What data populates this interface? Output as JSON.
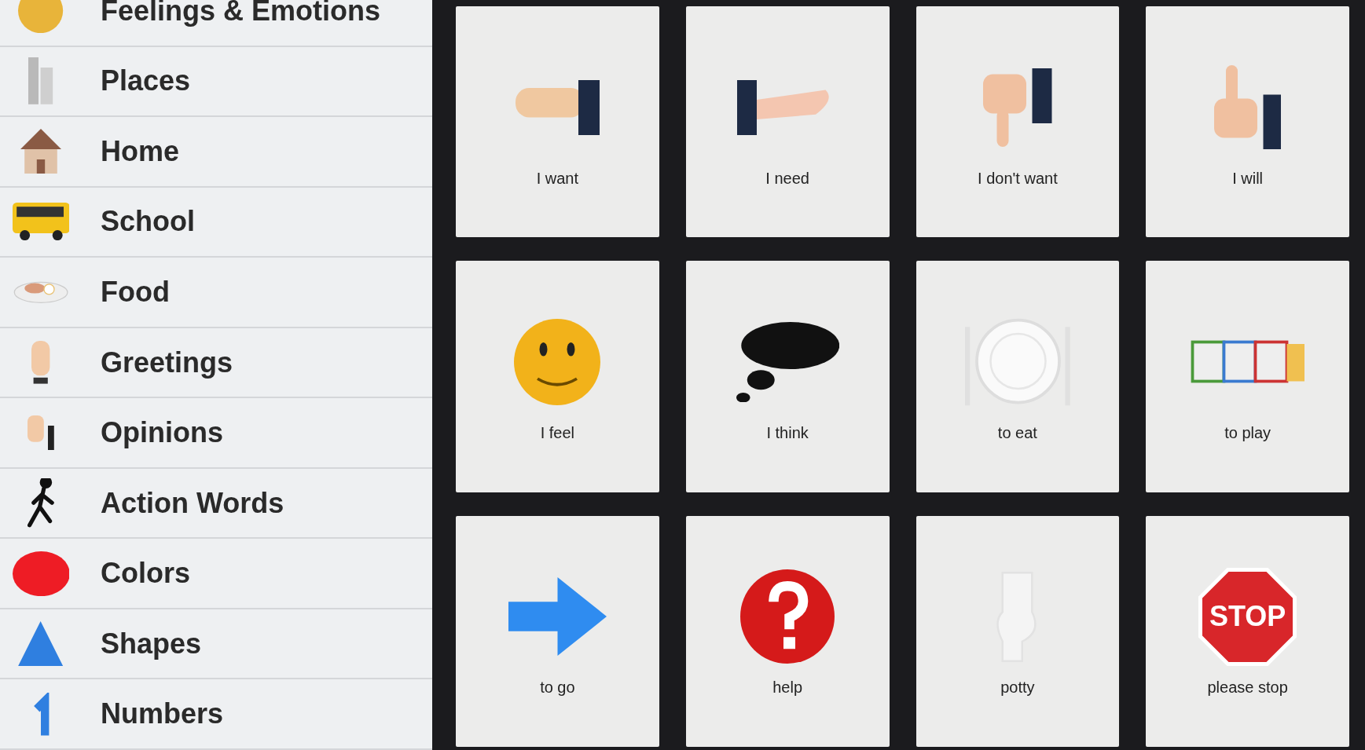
{
  "sidebar": {
    "items": [
      {
        "label": "Feelings & Emotions"
      },
      {
        "label": "Places"
      },
      {
        "label": "Home"
      },
      {
        "label": "School"
      },
      {
        "label": "Food"
      },
      {
        "label": "Greetings"
      },
      {
        "label": "Opinions"
      },
      {
        "label": "Action Words"
      },
      {
        "label": "Colors"
      },
      {
        "label": "Shapes"
      },
      {
        "label": "Numbers"
      }
    ]
  },
  "board": {
    "tiles": [
      {
        "label": "I want"
      },
      {
        "label": "I need"
      },
      {
        "label": "I don't want"
      },
      {
        "label": "I will"
      },
      {
        "label": "I feel"
      },
      {
        "label": "I think"
      },
      {
        "label": "to eat"
      },
      {
        "label": "to play"
      },
      {
        "label": "to go"
      },
      {
        "label": "help"
      },
      {
        "label": "potty"
      },
      {
        "label": "please stop",
        "sign_text": "STOP"
      }
    ]
  }
}
